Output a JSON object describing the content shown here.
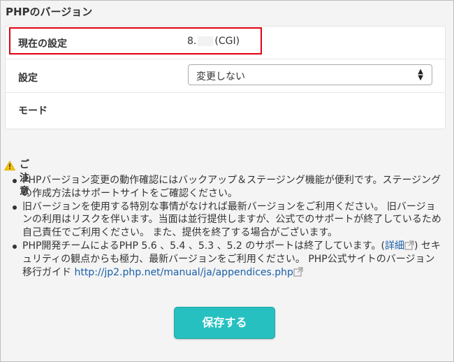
{
  "section_title": "PHPのバージョン",
  "settings": {
    "current_label": "現在の設定",
    "current_version_prefix": "8.",
    "current_version_suffix": "(CGI)",
    "setting_label": "設定",
    "setting_selected": "変更しない",
    "mode_label": "モード"
  },
  "notes": {
    "title": "ご注意",
    "item1": "PHPバージョン変更の動作確認にはバックアップ＆ステージング機能が便利です。ステージングの作成方法はサポートサイトをご確認ください。",
    "item2": "旧バージョンを使用する特別な事情がなければ最新バージョンをご利用ください。 旧バージョンの利用はリスクを伴います。当面は並行提供しますが、公式でのサポートが終了しているため自己責任でご利用ください。 また、提供を終了する場合がございます。",
    "item3_text1": "PHP開発チームによるPHP 5.6 、5.4 、5.3 、5.2 のサポートは終了しています。(",
    "item3_link1": "詳細",
    "item3_text2": ") セキュリティの観点からも極力、最新バージョンをご利用ください。 PHP公式サイトのバージョン移行ガイド ",
    "item3_link2": "http://jp2.php.net/manual/ja/appendices.php"
  },
  "save_button_label": "保存する",
  "colors": {
    "accent": "#27c0c0",
    "highlight": "#e00012",
    "link": "#1a5fa8",
    "warning": "#f5c400"
  },
  "icons": [
    "warning-icon",
    "external-link-icon",
    "select-arrows-icon"
  ]
}
